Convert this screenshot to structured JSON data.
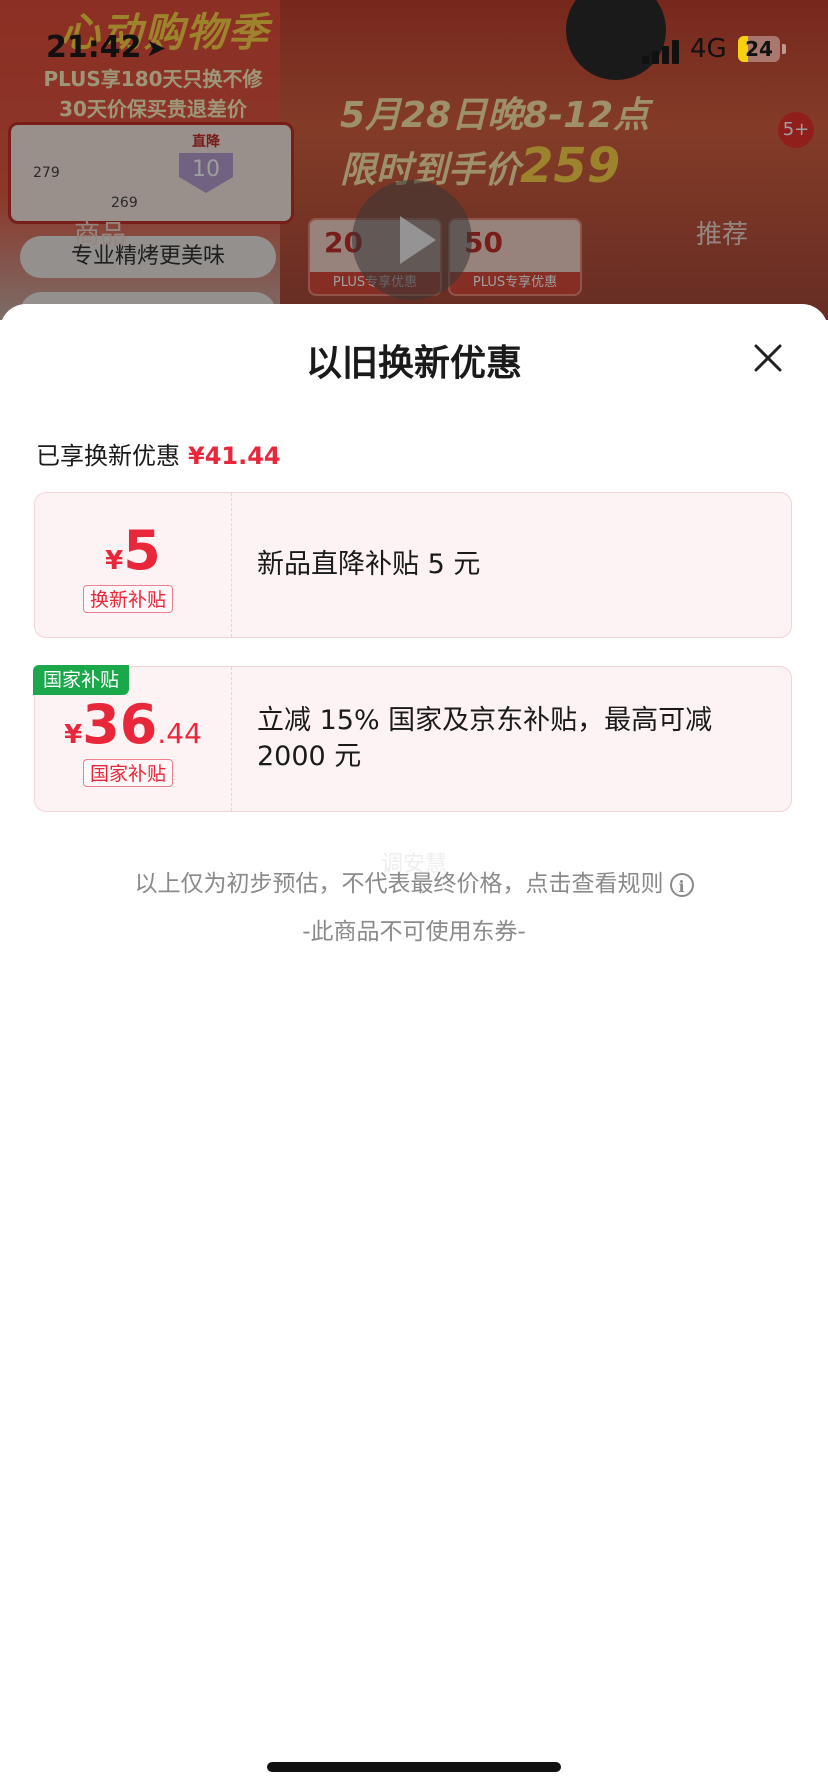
{
  "background": {
    "promo_title": "心动购物季",
    "plus_line1": "PLUS享180天只换不修",
    "plus_line2": "30天价保买贵退差价",
    "chart_price_a": "279",
    "chart_price_b": "269",
    "chart_drop_label": "直降",
    "chart_drop_value": "10",
    "feature_pill": "专业精烤更美味",
    "banner_line1": "5月28日晚8-12点",
    "banner_line2": "限时到手价",
    "banner_price": "259",
    "coupon1_amount": "20",
    "coupon1_label": "PLUS专享优惠",
    "coupon2_amount": "50",
    "coupon2_label": "PLUS专享优惠",
    "tab_left": "商品",
    "tab_right": "推荐",
    "badge_count": "5+"
  },
  "status_bar": {
    "time": "21:42",
    "network": "4G",
    "battery": "24"
  },
  "sheet": {
    "title": "以旧换新优惠",
    "summary_label": "已享换新优惠",
    "summary_amount": "¥41.44",
    "cards": [
      {
        "currency": "¥",
        "amount_int": "5",
        "amount_dec": "",
        "tag": "换新补贴",
        "badge": "",
        "description": "新品直降补贴 5 元"
      },
      {
        "currency": "¥",
        "amount_int": "36",
        "amount_dec": ".44",
        "tag": "国家补贴",
        "badge": "国家补贴",
        "description": "立减 15% 国家及京东补贴，最高可减 2000 元"
      }
    ],
    "disclaimer": "以上仅为初步预估，不代表最终价格，点击查看规则",
    "info_icon": "i",
    "ghost_text": "调安慧",
    "note": "-此商品不可使用东券-"
  }
}
